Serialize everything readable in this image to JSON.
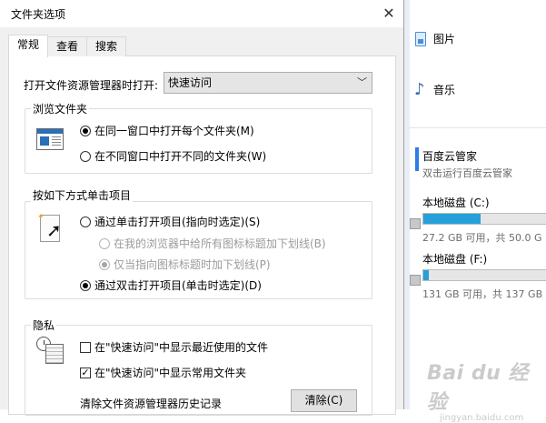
{
  "dialog": {
    "title": "文件夹选项",
    "tabs": [
      {
        "label": "常规"
      },
      {
        "label": "查看"
      },
      {
        "label": "搜索"
      }
    ],
    "open_in": {
      "label": "打开文件资源管理器时打开:",
      "selected": "快速访问"
    },
    "browse_folders": {
      "legend": "浏览文件夹",
      "same_window": "在同一窗口中打开每个文件夹(M)",
      "new_window": "在不同窗口中打开不同的文件夹(W)"
    },
    "click_items": {
      "legend": "按如下方式单击项目",
      "single_click": "通过单击打开项目(指向时选定)(S)",
      "underline_always": "在我的浏览器中给所有图标标题加下划线(B)",
      "underline_hover": "仅当指向图标标题时加下划线(P)",
      "double_click": "通过双击打开项目(单击时选定)(D)"
    },
    "privacy": {
      "legend": "隐私",
      "show_recent": "在\"快速访问\"中显示最近使用的文件",
      "show_frequent": "在\"快速访问\"中显示常用文件夹",
      "clear_history_label": "清除文件资源管理器历史记录",
      "clear_button": "清除(C)"
    }
  },
  "explorer": {
    "items": [
      {
        "label": "图片",
        "icon": "pictures-icon"
      },
      {
        "label": "音乐",
        "icon": "music-icon"
      }
    ],
    "app": {
      "title": "百度云管家",
      "subtitle": "双击运行百度云管家"
    },
    "drives": [
      {
        "name": "本地磁盘 (C:)",
        "size_text": "27.2 GB 可用，共 50.0 G",
        "used_fraction": 0.456
      },
      {
        "name": "本地磁盘 (F:)",
        "size_text": "131 GB 可用，共 137 GB",
        "used_fraction": 0.044
      }
    ]
  },
  "watermark": {
    "main": "Bai du 经验",
    "sub": "jingyan.baidu.com"
  }
}
